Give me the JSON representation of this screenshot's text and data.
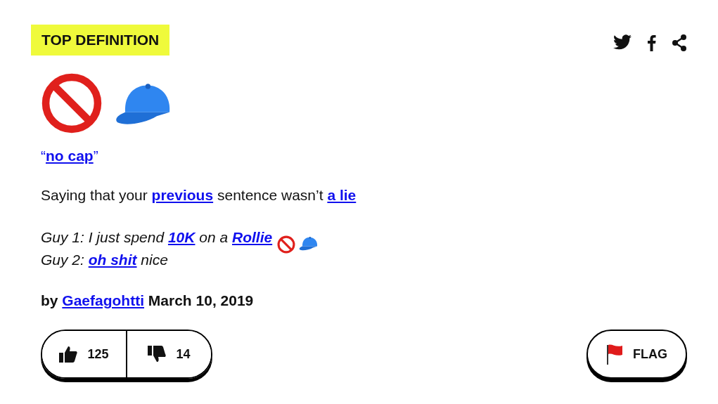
{
  "badge": "TOP DEFINITION",
  "word": {
    "open_quote": "“",
    "text": "no cap",
    "close_quote": "”"
  },
  "meaning": [
    {
      "kind": "text",
      "text": "Saying that your "
    },
    {
      "kind": "link",
      "text": "previous"
    },
    {
      "kind": "text",
      "text": " sentence wasn’t "
    },
    {
      "kind": "link",
      "text": "a lie"
    }
  ],
  "example": [
    [
      {
        "kind": "text",
        "text": "Guy 1: I just spend "
      },
      {
        "kind": "link",
        "text": "10K"
      },
      {
        "kind": "text",
        "text": " on a "
      },
      {
        "kind": "link",
        "text": "Rollie"
      }
    ],
    [
      {
        "kind": "text",
        "text": "Guy 2: "
      },
      {
        "kind": "link",
        "text": "oh shit"
      },
      {
        "kind": "text",
        "text": " nice"
      }
    ]
  ],
  "author": [
    {
      "kind": "text",
      "text": "by "
    },
    {
      "kind": "link",
      "text": "Gaefagohtti"
    },
    {
      "kind": "text",
      "text": " March 10, 2019"
    }
  ],
  "votes": {
    "up": "125",
    "down": "14"
  },
  "flag": "FLAG"
}
